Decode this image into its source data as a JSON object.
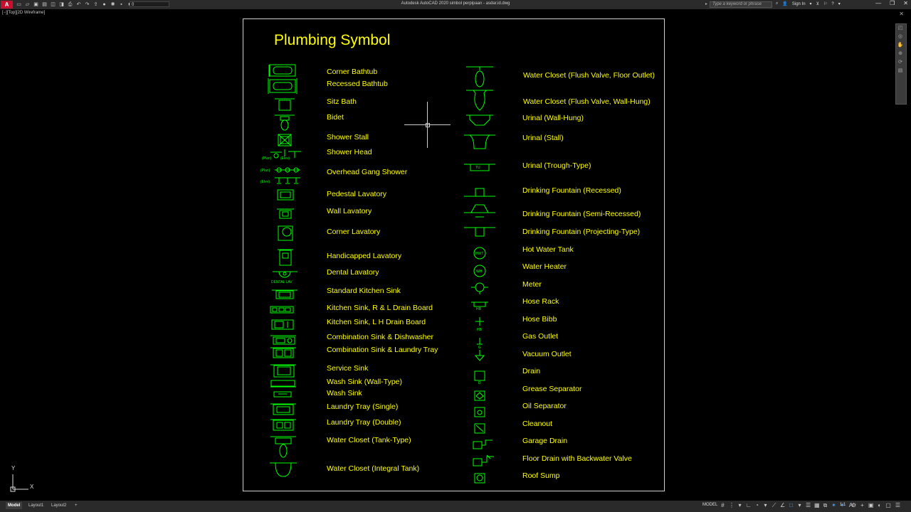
{
  "titlebar": {
    "app_logo": "A",
    "workspace_value": "0",
    "window_title": "Autodesk AutoCAD 2020    simbol perpipaan - asdar.id.dwg",
    "search_placeholder": "Type a keyword or phrase",
    "sign_in": "Sign In"
  },
  "viewport": {
    "label": "[−][Top][2D Wireframe]"
  },
  "drawing": {
    "title": "Plumbing Symbol",
    "left_labels": [
      "Corner Bathtub",
      "Recessed Bathtub",
      "Sitz Bath",
      "Bidet",
      "Shower Stall",
      "Shower Head",
      "Overhead Gang Shower",
      "Pedestal Lavatory",
      "Wall Lavatory",
      "Corner Lavatory",
      "Handicapped Lavatory",
      "Dental Lavatory",
      "Standard Kitchen Sink",
      "Kitchen Sink, R & L Drain Board",
      "Kitchen Sink, L H Drain Board",
      "Combination Sink & Dishwasher",
      "Combination Sink & Laundry Tray",
      "Service Sink",
      "Wash Sink (Wall-Type)",
      "Wash Sink",
      "Laundry Tray (Single)",
      "Laundry Tray (Double)",
      "Water Closet (Tank-Type)",
      "Water Closet (Integral Tank)"
    ],
    "right_labels": [
      "Water Closet (Flush Valve, Floor Outlet)",
      "Water Closet (Flush Valve, Wall-Hung)",
      "Urinal (Wall-Hung)",
      "Urinal (Stall)",
      "Urinal (Trough-Type)",
      "Drinking Fountain (Recessed)",
      "Drinking Fountain (Semi-Recessed)",
      "Drinking Fountain (Projecting-Type)",
      "Hot Water Tank",
      "Water Heater",
      "Meter",
      "Hose Rack",
      "Hose Bibb",
      "Gas Outlet",
      "Vacuum Outlet",
      "Drain",
      "Grease Separator",
      "Oil Separator",
      "Cleanout",
      "Garage Drain",
      "Floor Drain with Backwater Valve",
      "Roof Sump"
    ],
    "symbol_texts": {
      "plan": "(Plan)",
      "elev": "(Elev)",
      "dental_lav": "DENTAL LAV",
      "hwt": "HWT",
      "wh": "WH",
      "hr": "HR",
      "hb": "HB",
      "g": "G",
      "d": "D",
      "tu": "TU"
    },
    "line_color": "#00ff00",
    "text_color": "#ffff00"
  },
  "ucs": {
    "x": "X",
    "y": "Y"
  },
  "statusbar": {
    "tabs": [
      "Model",
      "Layout1",
      "Layout2",
      "+"
    ],
    "model_indicator": "MODEL",
    "scale": "1:1"
  }
}
